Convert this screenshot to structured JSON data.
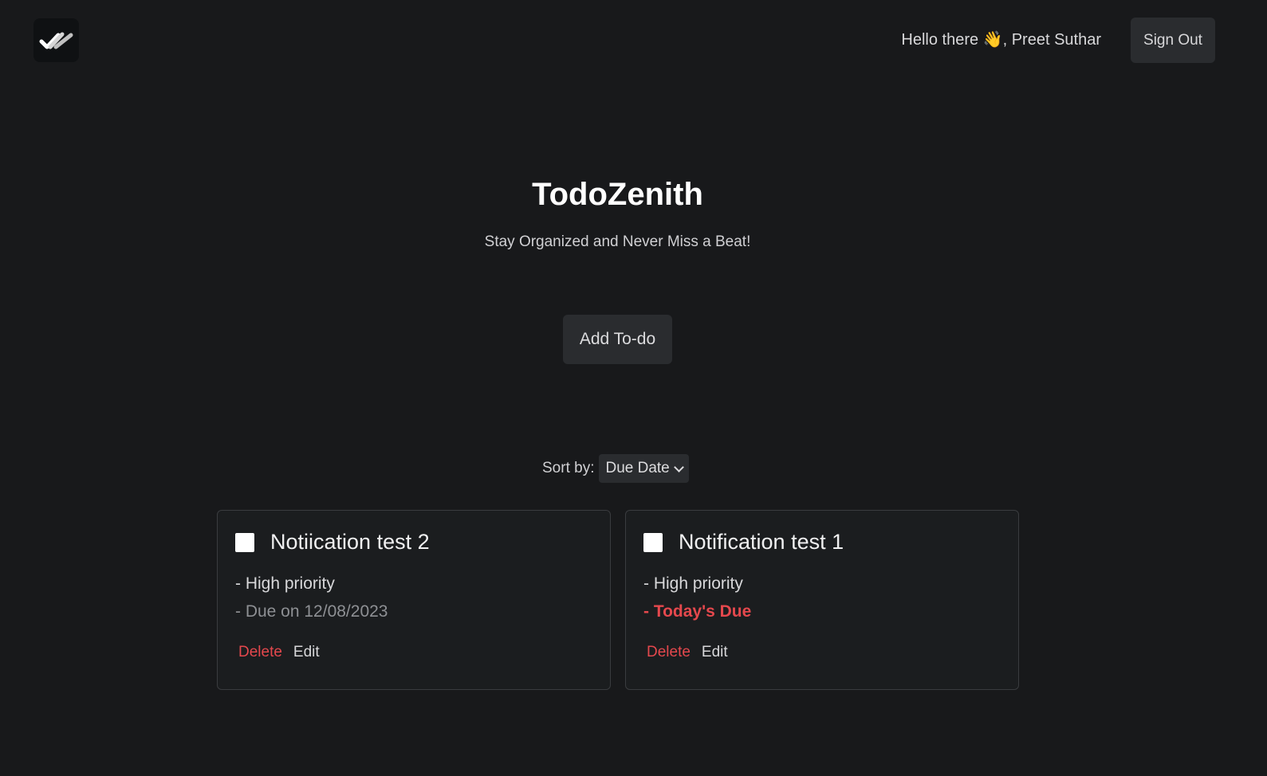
{
  "header": {
    "logo_icon": "double-check-icon",
    "greeting": "Hello there 👋, Preet Suthar",
    "sign_out_label": "Sign Out"
  },
  "hero": {
    "title": "TodoZenith",
    "subtitle": "Stay Organized and Never Miss a Beat!",
    "add_button_label": "Add To-do"
  },
  "sort": {
    "label": "Sort by:",
    "selected": "Due Date"
  },
  "todos": [
    {
      "title": "Notiication test 2",
      "priority": "- High priority",
      "due": "- Due on 12/08/2023",
      "delete_label": "Delete",
      "edit_label": "Edit"
    },
    {
      "title": "Notification test 1",
      "priority": "- High priority",
      "due": "- Today's Due",
      "delete_label": "Delete",
      "edit_label": "Edit"
    }
  ],
  "colors": {
    "background": "#18191b",
    "danger": "#e5484d",
    "button": "#2a2c2f"
  }
}
